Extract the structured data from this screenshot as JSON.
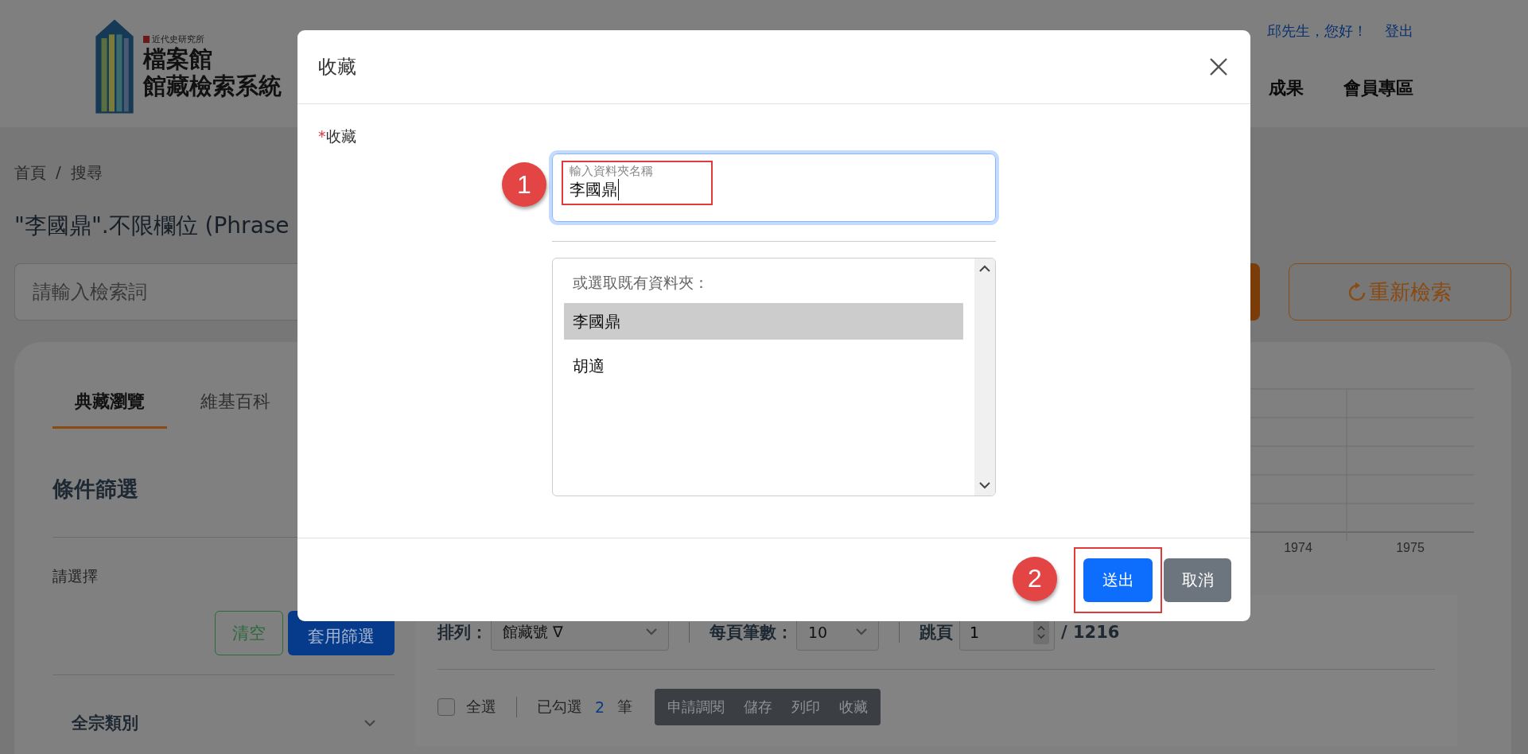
{
  "header": {
    "logo_small": "近代史研究所",
    "logo_title": "檔案館",
    "logo_subtitle": "館藏檢索系統",
    "greeting": "邱先生，您好！",
    "logout": "登出",
    "nav": [
      {
        "label": "成果"
      },
      {
        "label": "會員專區"
      }
    ]
  },
  "breadcrumb": {
    "items": [
      "首頁",
      "搜尋"
    ],
    "separator": "/"
  },
  "query_title": "\"李國鼎\".不限欄位 (Phrase",
  "search": {
    "placeholder": "請輸入檢索詞"
  },
  "reset_button": "重新檢索",
  "tabs": [
    {
      "label": "典藏瀏覽",
      "selected": true
    },
    {
      "label": "維基百科",
      "selected": false
    }
  ],
  "filter": {
    "heading": "條件篩選",
    "prompt": "請選擇",
    "clear_button": "清空",
    "apply_button": "套用篩選",
    "sections": [
      {
        "label": "全宗類別",
        "expanded": false
      }
    ]
  },
  "chart": {
    "labels": [
      "1974",
      "1975"
    ]
  },
  "results_toolbar": {
    "sort_label": "排列：",
    "sort_value": "館藏號 ∇",
    "per_page_label": "每頁筆數：",
    "per_page_value": "10",
    "jump_label": "跳頁",
    "jump_value": "1",
    "total_pages": "/ 1216",
    "select_all": {
      "label": "全選",
      "checked": false
    },
    "selected_prefix": "已勾選",
    "selected_count": "2",
    "selected_suffix": "筆",
    "actions": [
      "申請調閱",
      "儲存",
      "列印",
      "收藏"
    ]
  },
  "modal": {
    "title": "收藏",
    "required_mark": "*",
    "field_label": "收藏",
    "name_field": {
      "label": "輸入資料夾名稱",
      "value": "李國鼎",
      "callout": "1"
    },
    "folder_list": {
      "hint": "或選取既有資料夾：",
      "items": [
        {
          "label": "李國鼎",
          "selected": true
        },
        {
          "label": "胡適",
          "selected": false
        }
      ]
    },
    "buttons": [
      {
        "label": "送出",
        "kind": "primary",
        "callout": "2"
      },
      {
        "label": "取消",
        "kind": "secondary"
      }
    ]
  }
}
